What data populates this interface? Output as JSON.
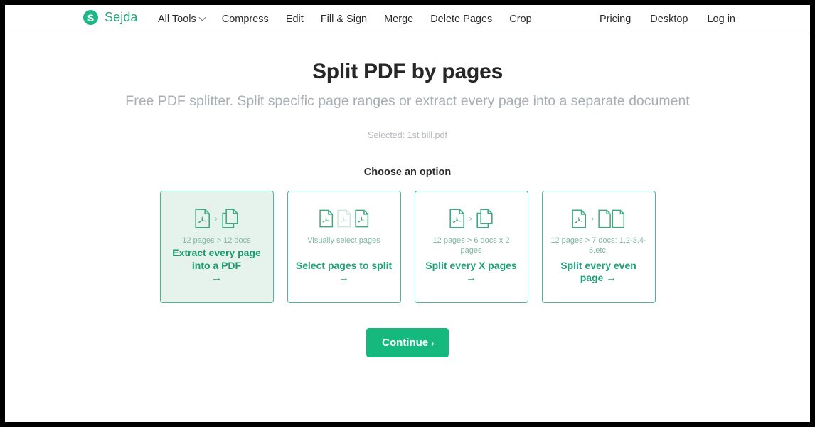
{
  "brand": {
    "logo_mark": "S",
    "name": "Sejda",
    "accent": "#1fb787",
    "logo_icon": "sejda-circle-logo-icon"
  },
  "header": {
    "nav_left": [
      {
        "label": "All Tools",
        "has_dropdown": true
      },
      {
        "label": "Compress",
        "has_dropdown": false
      },
      {
        "label": "Edit",
        "has_dropdown": false
      },
      {
        "label": "Fill & Sign",
        "has_dropdown": false
      },
      {
        "label": "Merge",
        "has_dropdown": false
      },
      {
        "label": "Delete Pages",
        "has_dropdown": false
      },
      {
        "label": "Crop",
        "has_dropdown": false
      }
    ],
    "nav_right": [
      {
        "label": "Pricing"
      },
      {
        "label": "Desktop"
      },
      {
        "label": "Log in"
      }
    ]
  },
  "main": {
    "title": "Split PDF by pages",
    "subtitle": "Free PDF splitter. Split specific page ranges or extract every page into a separate document",
    "selected_file": "Selected: 1st bill.pdf",
    "choose_label": "Choose an option",
    "options": [
      {
        "sub": "12 pages > 12 docs",
        "cta": "Extract every page into a PDF",
        "arrow": "→",
        "selected": true,
        "icon_set": "pdf-to-copies-icon"
      },
      {
        "sub": "Visually select pages",
        "cta": "Select pages to split",
        "arrow": "→",
        "selected": false,
        "icon_set": "three-pdf-pages-icon"
      },
      {
        "sub": "12 pages > 6 docs x 2 pages",
        "cta": "Split every X pages",
        "arrow": "→",
        "selected": false,
        "icon_set": "pdf-to-copies-icon"
      },
      {
        "sub": "12 pages > 7 docs: 1,2-3,4-5,etc.",
        "cta": "Split every even page",
        "arrow": "→",
        "selected": false,
        "icon_set": "pdf-to-two-docs-icon"
      }
    ],
    "continue_label": "Continue",
    "continue_caret": "›"
  }
}
